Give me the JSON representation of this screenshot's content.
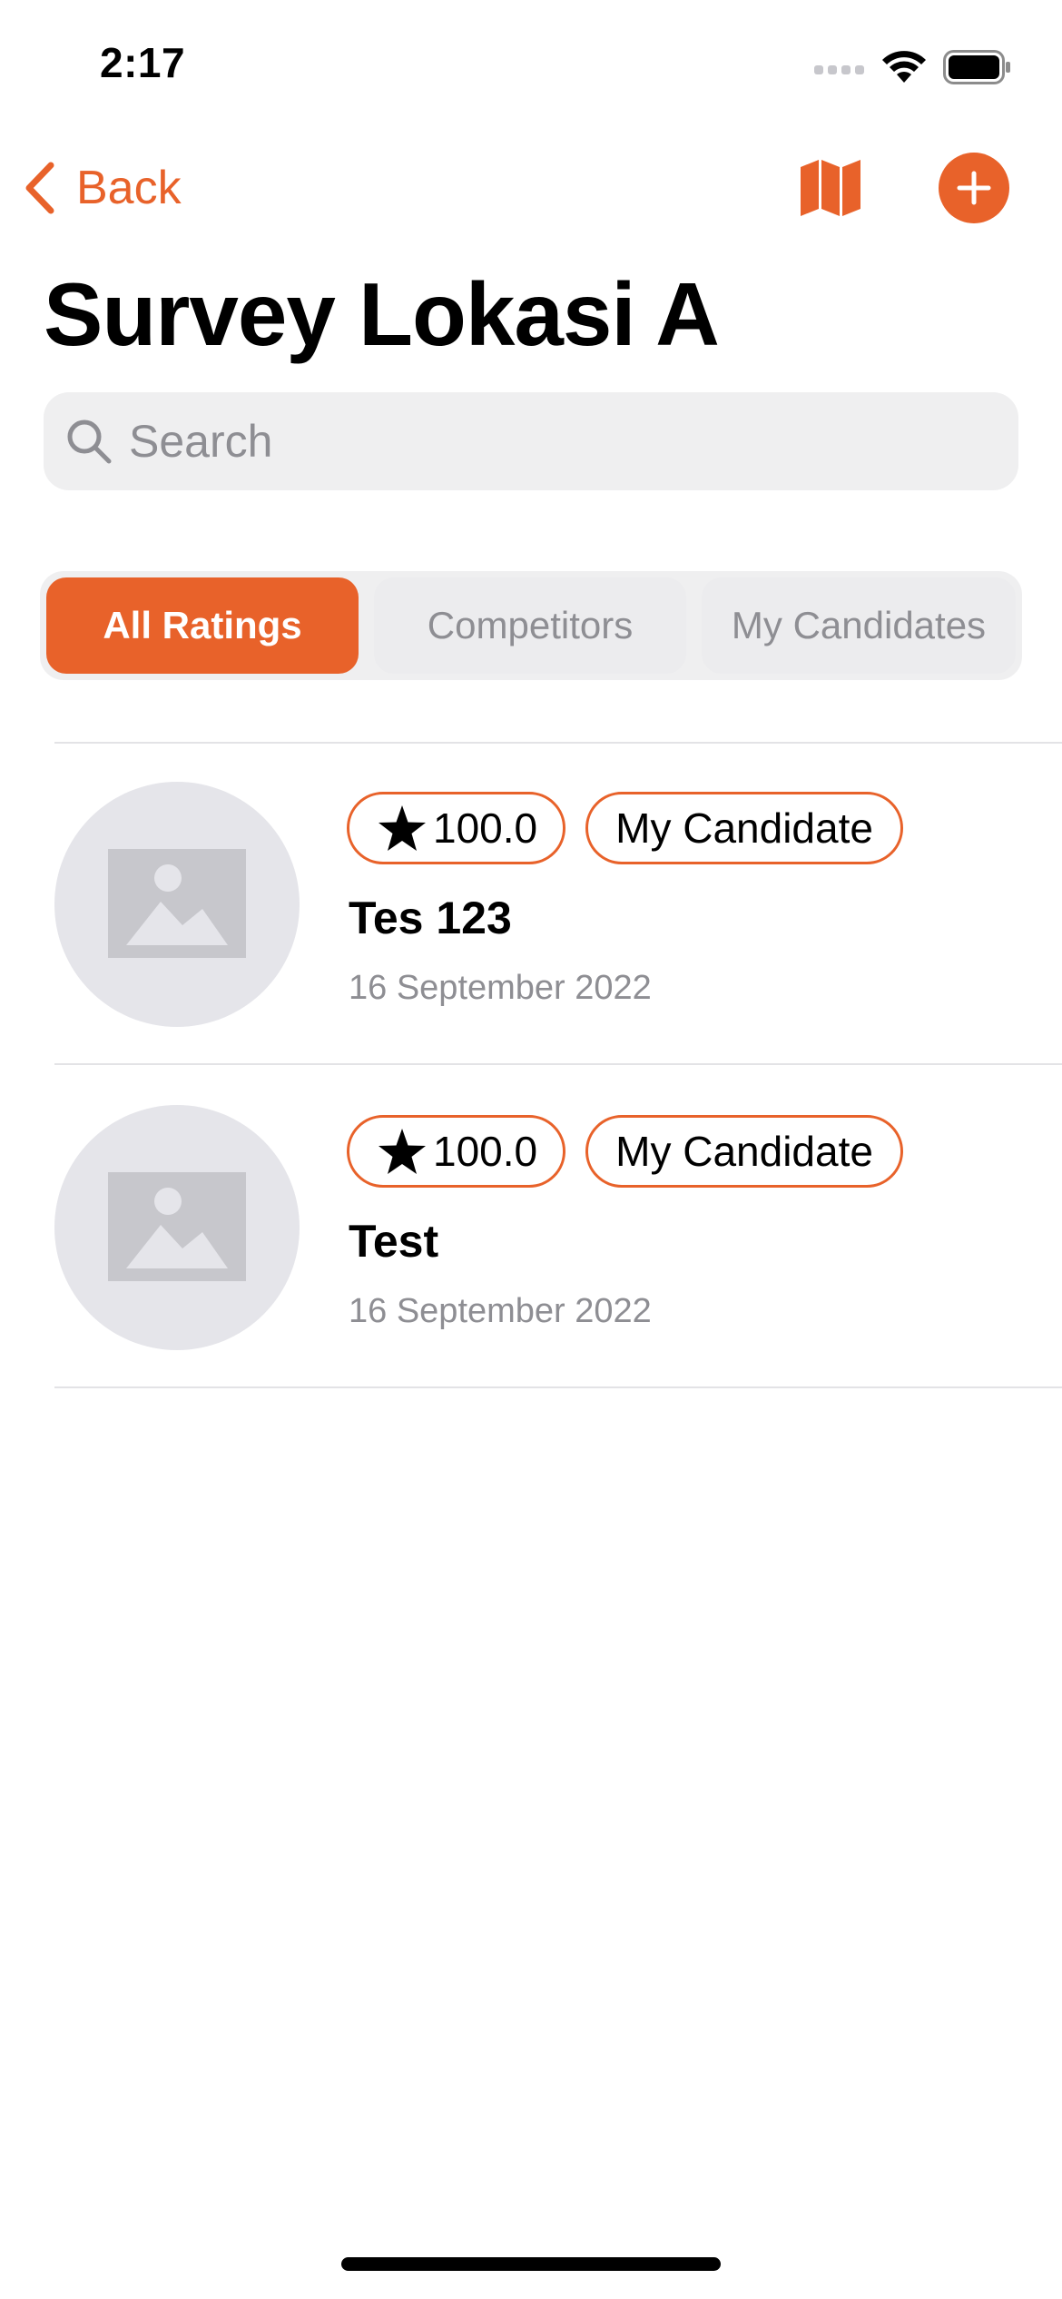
{
  "status_bar": {
    "time": "2:17",
    "icons": [
      "cellular-signal-icon",
      "wifi-icon",
      "battery-icon"
    ]
  },
  "nav": {
    "back_label": "Back",
    "back_icon": "chevron-left-icon",
    "map_icon": "map-icon",
    "add_icon": "plus-circle-icon"
  },
  "page": {
    "title": "Survey Lokasi A"
  },
  "search": {
    "placeholder": "Search",
    "value": ""
  },
  "segments": {
    "selected": "All Ratings",
    "items": [
      {
        "label": "All Ratings",
        "active": true
      },
      {
        "label": "Competitors",
        "active": false
      },
      {
        "label": "My Candidates",
        "active": false
      }
    ]
  },
  "list": {
    "items": [
      {
        "rating": "100.0",
        "tag": "My Candidate",
        "title": "Tes 123",
        "date": "16 September 2022"
      },
      {
        "rating": "100.0",
        "tag": "My Candidate",
        "title": "Test",
        "date": "16 September 2022"
      }
    ]
  },
  "colors": {
    "accent": "#E8622A",
    "placeholder_circle": "#E5E5EA",
    "placeholder_image": "#C7C7CC",
    "secondary_text": "#8E8E93",
    "search_background": "#EFEFF0"
  }
}
